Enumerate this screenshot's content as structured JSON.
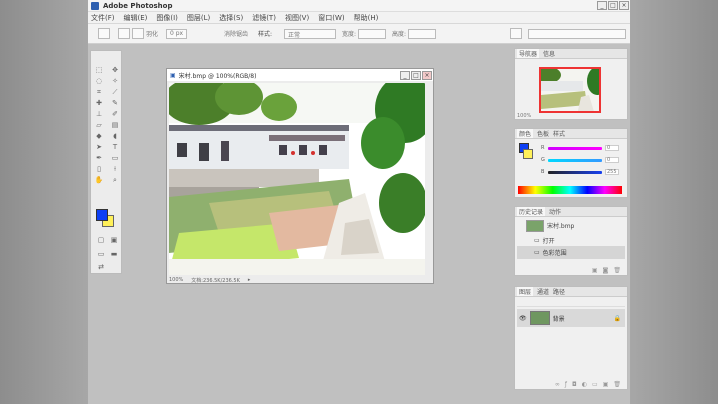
{
  "app": {
    "title": "Adobe Photoshop",
    "window_controls": [
      "_",
      "□",
      "×"
    ]
  },
  "menu": [
    "文件(F)",
    "编辑(E)",
    "图像(I)",
    "图层(L)",
    "选择(S)",
    "滤镜(T)",
    "视图(V)",
    "窗口(W)",
    "帮助(H)"
  ],
  "options": {
    "feather_label": "羽化",
    "feather_value": "0 px",
    "antialias_label": "消除锯齿",
    "style_label": "样式:",
    "style_value": "正常",
    "width_label": "宽度:",
    "height_label": "高度:"
  },
  "document": {
    "title": "宋村.bmp @ 100%(RGB/8)",
    "zoom": "100%",
    "status": "文档:236.5K/236.5K"
  },
  "panels": {
    "navigator": {
      "tabs": [
        "导航器",
        "信息"
      ],
      "zoom": "100%"
    },
    "color": {
      "tabs": [
        "颜色",
        "色板",
        "样式"
      ],
      "channels": [
        {
          "label": "R",
          "value": "0"
        },
        {
          "label": "G",
          "value": "0"
        },
        {
          "label": "B",
          "value": "255"
        }
      ]
    },
    "history": {
      "tabs": [
        "历史记录",
        "动作"
      ],
      "items": [
        "宋村.bmp",
        "打开",
        "色彩范围"
      ]
    },
    "layers": {
      "tabs": [
        "图层",
        "通道",
        "路径"
      ],
      "layer_name": "背景"
    }
  },
  "colors": {
    "foreground": "#0d3ff5",
    "background": "#fff15a"
  }
}
